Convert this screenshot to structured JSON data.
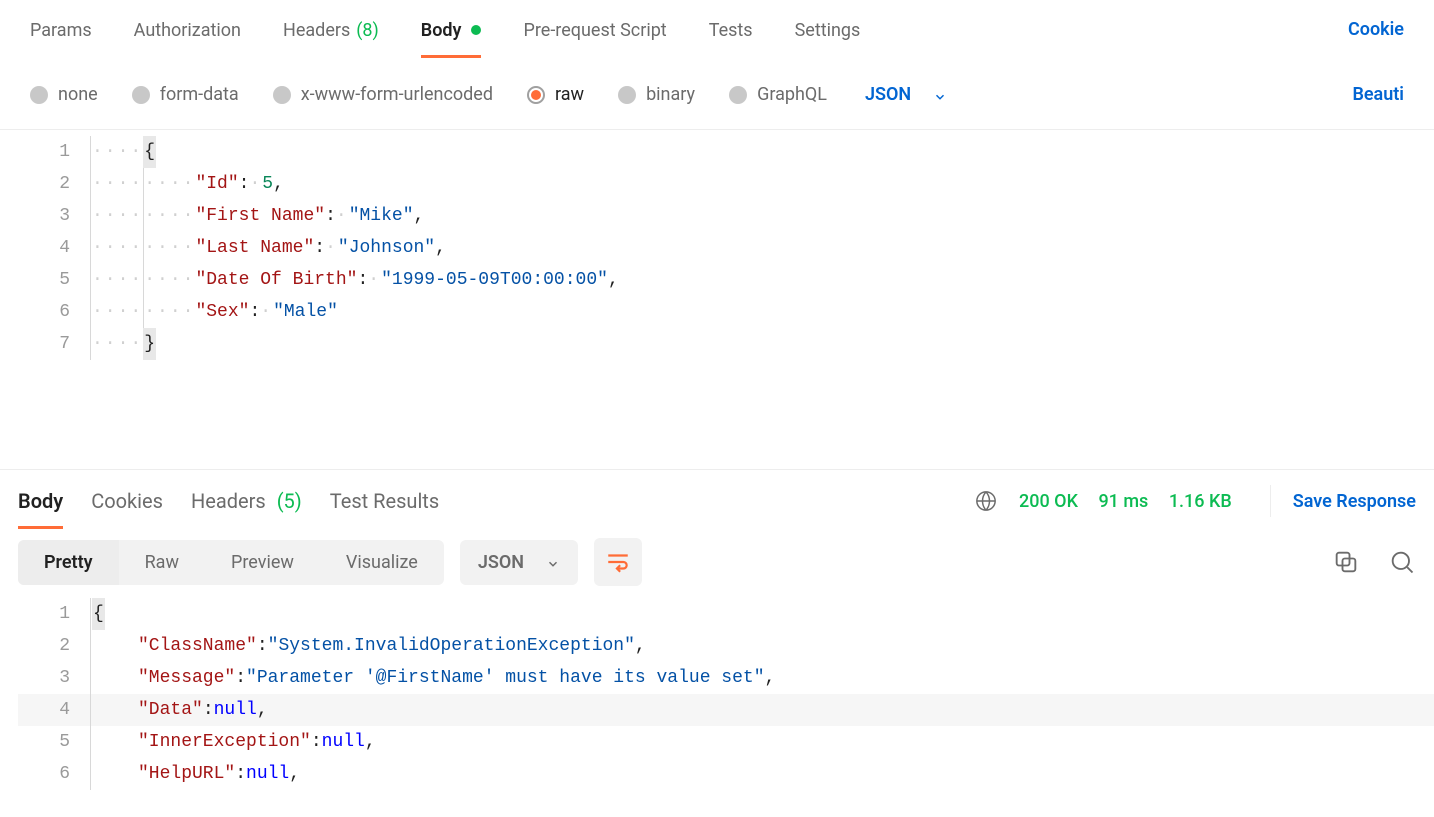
{
  "request_tabs": {
    "params": "Params",
    "authorization": "Authorization",
    "headers": "Headers",
    "headers_count": "(8)",
    "body": "Body",
    "prereq": "Pre-request Script",
    "tests": "Tests",
    "settings": "Settings",
    "cookies_link": "Cookie"
  },
  "body_types": {
    "none": "none",
    "formdata": "form-data",
    "urlencoded": "x-www-form-urlencoded",
    "raw": "raw",
    "binary": "binary",
    "graphql": "GraphQL",
    "format": "JSON",
    "beautify": "Beauti"
  },
  "request_body": {
    "lines": [
      "1",
      "2",
      "3",
      "4",
      "5",
      "6",
      "7"
    ],
    "brace_open": "{",
    "brace_close": "}",
    "k_id": "\"Id\"",
    "v_id": "5",
    "k_fn": "\"First Name\"",
    "v_fn": "\"Mike\"",
    "k_ln": "\"Last Name\"",
    "v_ln": "\"Johnson\"",
    "k_dob": "\"Date Of Birth\"",
    "v_dob": "\"1999-05-09T00:00:00\"",
    "k_sex": "\"Sex\"",
    "v_sex": "\"Male\""
  },
  "response_tabs": {
    "body": "Body",
    "cookies": "Cookies",
    "headers": "Headers",
    "headers_count": "(5)",
    "test_results": "Test Results",
    "status": "200 OK",
    "time": "91 ms",
    "size": "1.16 KB",
    "save": "Save Response"
  },
  "view_controls": {
    "pretty": "Pretty",
    "raw": "Raw",
    "preview": "Preview",
    "visualize": "Visualize",
    "format": "JSON"
  },
  "response_body": {
    "lines": [
      "1",
      "2",
      "3",
      "4",
      "5",
      "6"
    ],
    "brace_open": "{",
    "k_class": "\"ClassName\"",
    "v_class": "\"System.InvalidOperationException\"",
    "k_msg": "\"Message\"",
    "v_msg": "\"Parameter '@FirstName' must have its value set\"",
    "k_data": "\"Data\"",
    "v_null": "null",
    "k_inner": "\"InnerException\"",
    "k_help": "\"HelpURL\""
  }
}
